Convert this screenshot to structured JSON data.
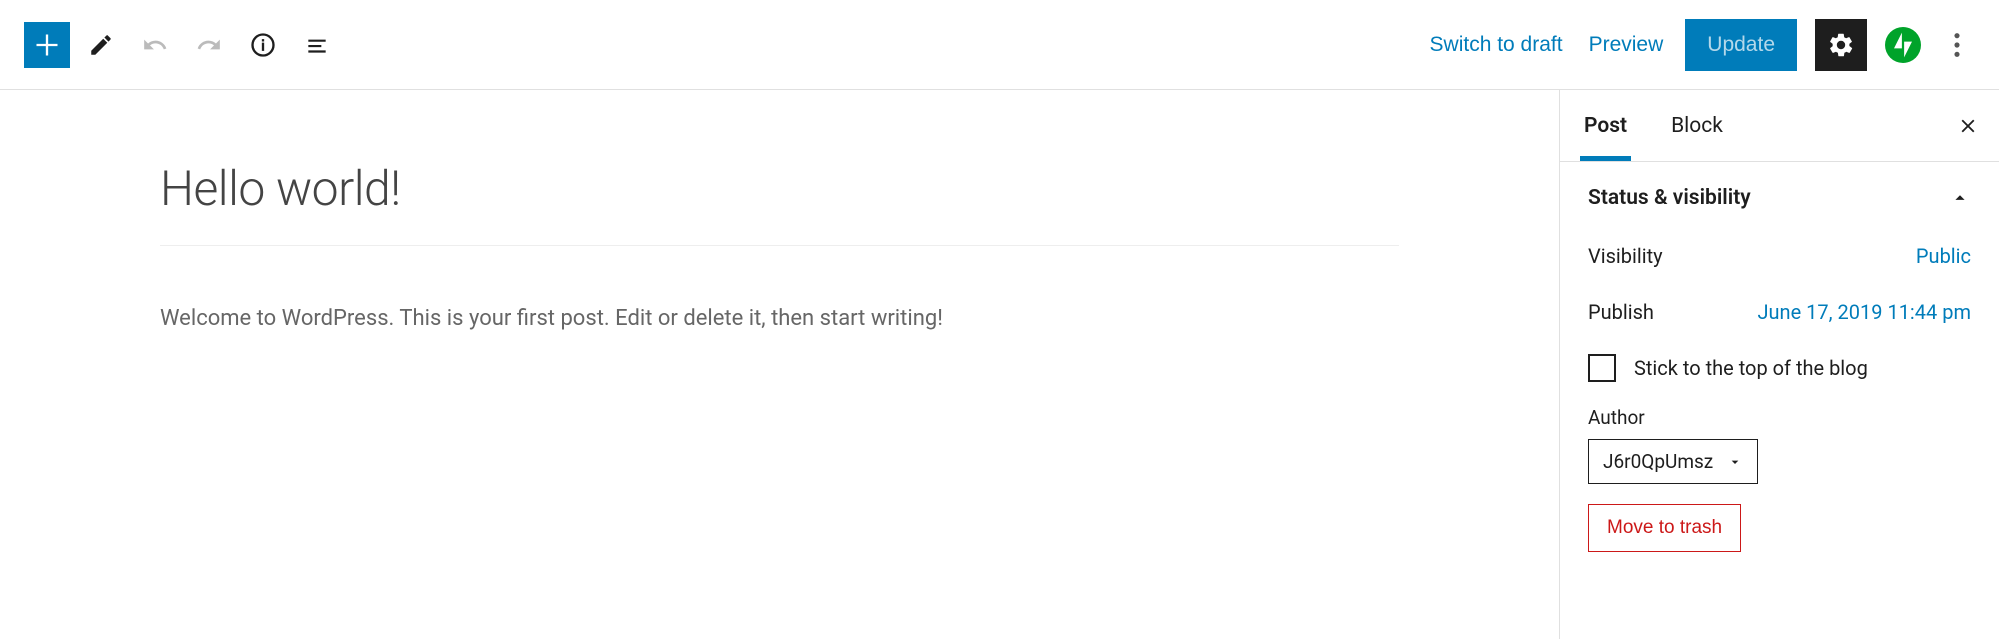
{
  "toolbar": {
    "switch_draft": "Switch to draft",
    "preview": "Preview",
    "update": "Update"
  },
  "editor": {
    "title": "Hello world!",
    "body": "Welcome to WordPress. This is your first post. Edit or delete it, then start writing!"
  },
  "sidebar": {
    "tabs": {
      "post": "Post",
      "block": "Block"
    },
    "status_panel": {
      "title": "Status & visibility",
      "visibility_label": "Visibility",
      "visibility_value": "Public",
      "publish_label": "Publish",
      "publish_value": "June 17, 2019 11:44 pm",
      "sticky_label": "Stick to the top of the blog",
      "author_label": "Author",
      "author_value": "J6r0QpUmsz",
      "trash_label": "Move to trash"
    }
  }
}
